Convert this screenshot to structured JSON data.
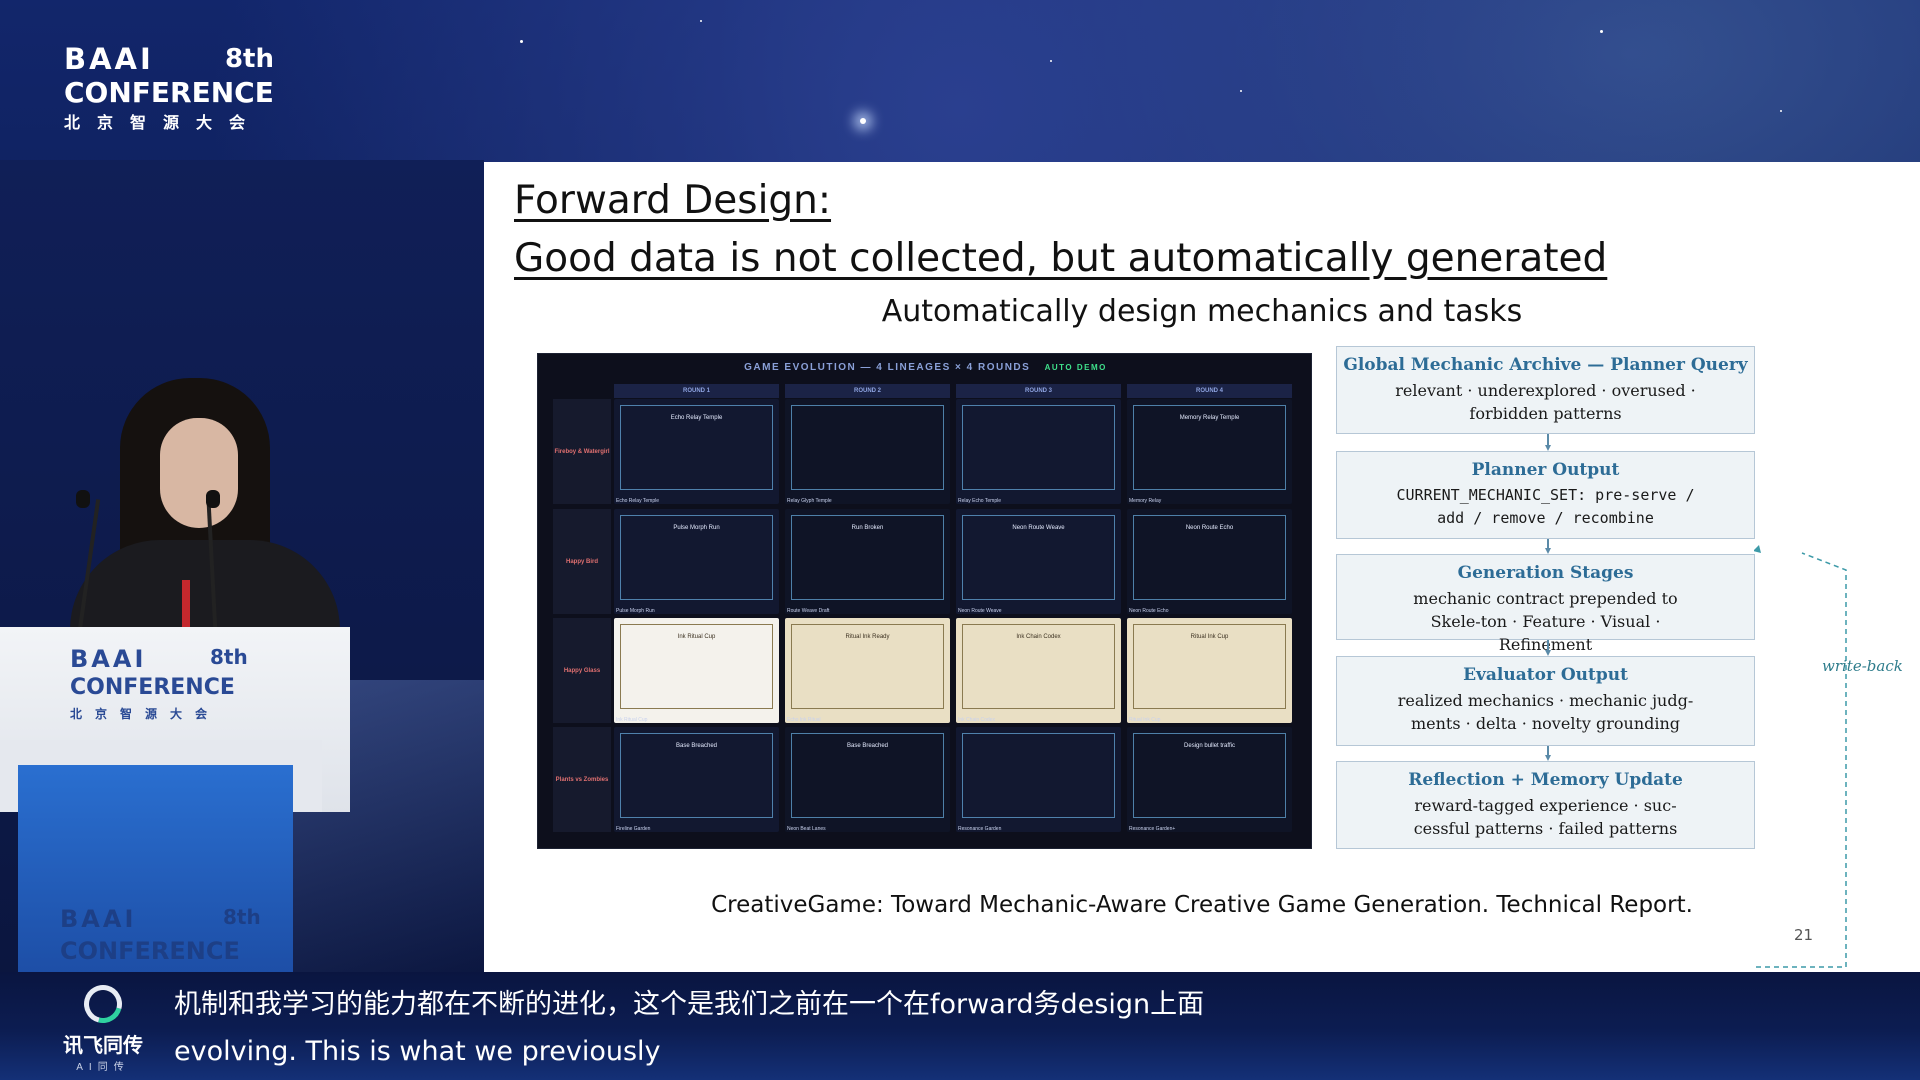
{
  "logo": {
    "baai": "BAAI",
    "edition": "8th",
    "conference": "CONFERENCE",
    "chinese": "北京智源大会"
  },
  "slide": {
    "title_line1": "Forward Design:",
    "title_line2": "Good data is not collected, but automatically generated",
    "subtitle": "Automatically design mechanics and tasks",
    "grid": {
      "header": "GAME EVOLUTION — 4 LINEAGES × 4 ROUNDS",
      "badge": "AUTO DEMO",
      "rounds": [
        "ROUND 1",
        "ROUND 2",
        "ROUND 3",
        "ROUND 4"
      ],
      "lineages": [
        "Fireboy & Watergirl",
        "Happy Bird",
        "Happy Glass",
        "Plants vs Zombies"
      ],
      "captions": [
        [
          "Echo Relay Temple",
          "Relay Glyph Temple",
          "Relay Echo Temple",
          "Memory Relay"
        ],
        [
          "Pulse Morph Run",
          "Route Weave Draft",
          "Neon Route Weave",
          "Neon Route Echo"
        ],
        [
          "Ink Ritual Cup",
          "Echo Ink Ritual",
          "Ink Chain Codex",
          "Ritual Ink Cup"
        ],
        [
          "Fireline Garden",
          "Neon Beat Lanes",
          "Resonance Garden",
          "Resonance Garden+"
        ]
      ],
      "inner_titles": [
        [
          "Echo Relay Temple",
          "",
          "",
          "Memory Relay Temple"
        ],
        [
          "Pulse Morph Run",
          "Run Broken",
          "Neon Route Weave",
          "Neon Route Echo"
        ],
        [
          "Ink Ritual Cup",
          "Ritual Ink Ready",
          "Ink Chain Codex",
          "Ritual Ink Cup"
        ],
        [
          "Base Breached",
          "Base Breached",
          "",
          "Design bullet traffic"
        ]
      ]
    },
    "pipeline": [
      {
        "title": "Global Mechanic Archive — Planner Query",
        "body": "relevant · underexplored · overused · forbidden patterns",
        "mono": false
      },
      {
        "title": "Planner Output",
        "body": "CURRENT_MECHANIC_SET: pre-serve / add / remove / recombine",
        "mono": true
      },
      {
        "title": "Generation Stages",
        "body": "mechanic contract prepended to Skele-ton · Feature · Visual · Refinement",
        "mono": false
      },
      {
        "title": "Evaluator Output",
        "body": "realized mechanics · mechanic judg-ments · delta · novelty grounding",
        "mono": false
      },
      {
        "title": "Reflection + Memory Update",
        "body": "reward-tagged experience · suc-cessful patterns · failed patterns",
        "mono": false
      }
    ],
    "writeback_label": "write-back",
    "citation": "CreativeGame: Toward Mechanic-Aware Creative Game Generation. Technical Report.",
    "page_number": "21"
  },
  "subtitles": {
    "brand": "讯飞同传",
    "brand_tag": "AI同传",
    "line_zh": "机制和我学习的能力都在不断的进化，这个是我们之前在一个在forward务design上面",
    "line_en": "evolving. This is what we previously"
  },
  "colors": {
    "accent": "#2d6c96",
    "background": "#0b1a4a"
  }
}
